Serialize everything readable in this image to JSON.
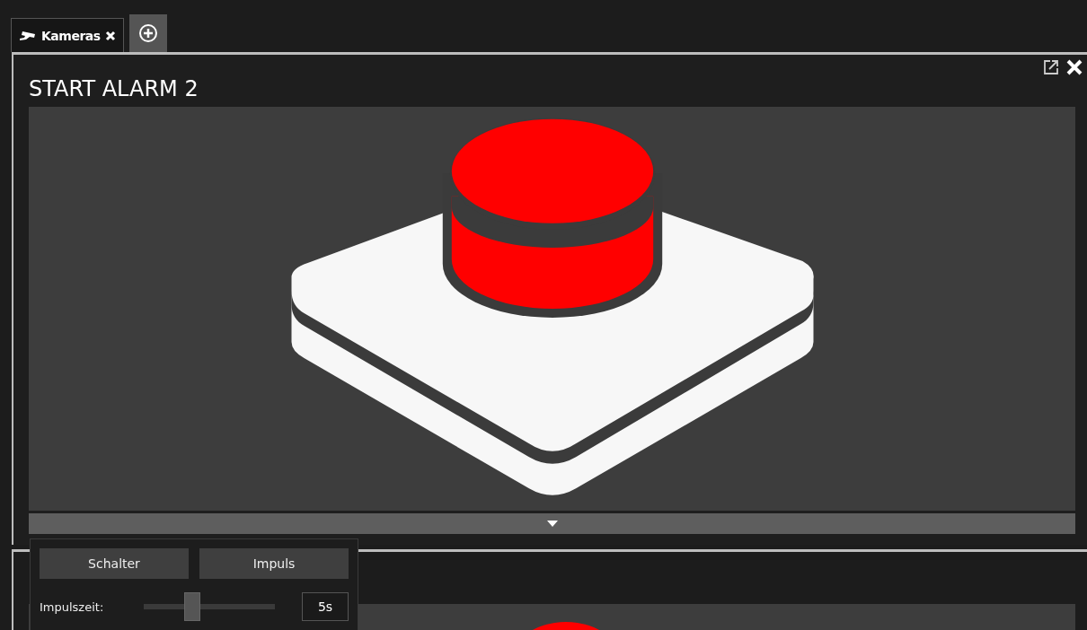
{
  "tabs": [
    {
      "label": "Kameras",
      "selected": true
    }
  ],
  "panels": [
    {
      "title": "START ALARM 2"
    }
  ],
  "control_popup": {
    "buttons": [
      "Schalter",
      "Impuls"
    ],
    "slider": {
      "label": "Impulszeit:",
      "level": 0.37
    },
    "value": "5s"
  }
}
